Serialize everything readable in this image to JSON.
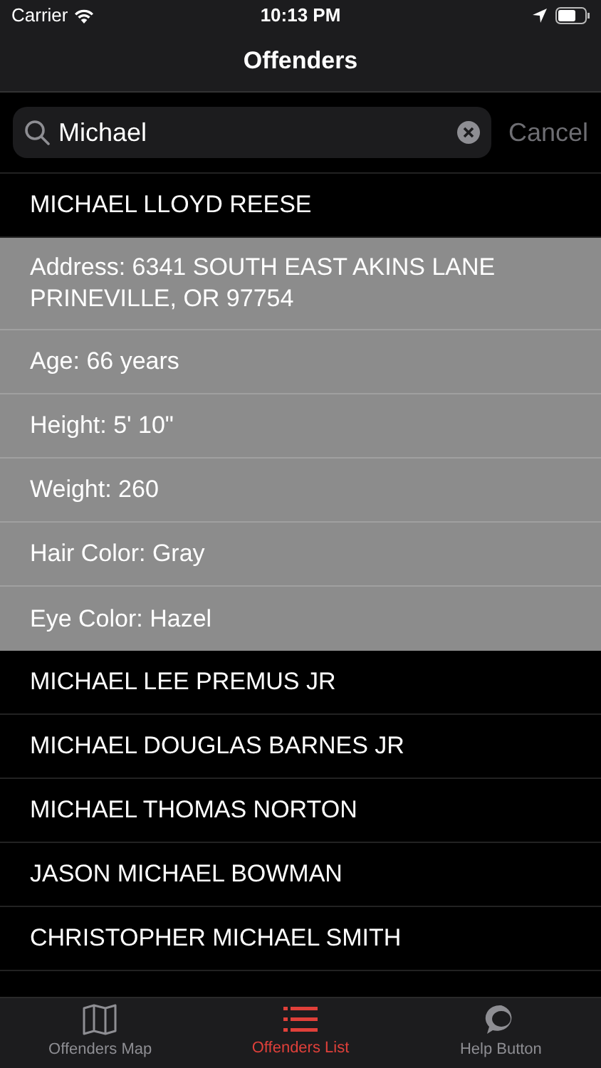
{
  "status_bar": {
    "carrier": "Carrier",
    "time": "10:13 PM"
  },
  "nav_bar": {
    "title": "Offenders"
  },
  "search": {
    "value": "Michael",
    "cancel": "Cancel"
  },
  "results": [
    {
      "name": "MICHAEL LLOYD REESE",
      "details": [
        "Address: 6341 SOUTH EAST AKINS LANE PRINEVILLE, OR 97754",
        "Age: 66 years",
        "Height: 5' 10\"",
        "Weight: 260",
        "Hair Color: Gray",
        "Eye Color: Hazel"
      ]
    },
    {
      "name": "MICHAEL LEE PREMUS JR"
    },
    {
      "name": "MICHAEL DOUGLAS BARNES JR"
    },
    {
      "name": "MICHAEL THOMAS NORTON"
    },
    {
      "name": "JASON MICHAEL BOWMAN"
    },
    {
      "name": "CHRISTOPHER MICHAEL SMITH"
    }
  ],
  "tab_bar": [
    {
      "kind": "map",
      "label": "Offenders Map",
      "selected": false
    },
    {
      "kind": "list",
      "label": "Offenders List",
      "selected": true
    },
    {
      "kind": "chat",
      "label": "Help Button",
      "selected": false
    }
  ]
}
